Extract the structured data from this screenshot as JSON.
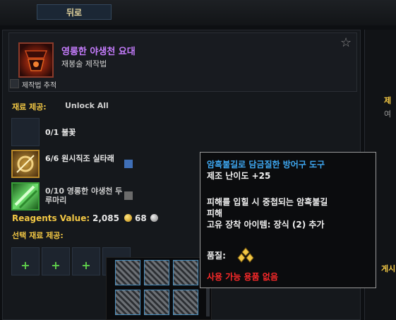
{
  "nav": {
    "back_label": "뒤로"
  },
  "recipe": {
    "name": "영롱한 야생천 요대",
    "subtitle": "재봉술 제작법",
    "track_label": "제작법 추적",
    "favorite_icon": "star-icon"
  },
  "reagents_section": {
    "label": "재료 제공:",
    "unlock_all": "Unlock All",
    "rows": [
      {
        "text": "0/1 불꽃",
        "icon": "empty-slot"
      },
      {
        "text": "6/6 원시직조 실타래",
        "icon": "thread-icon",
        "quality_color": "#3f6fb7"
      },
      {
        "text": "0/10 영롱한 야생천 두루마리",
        "icon": "cloth-roll-icon",
        "quality_color": "#6b6b6b"
      }
    ]
  },
  "reagent_value": {
    "label": "Reagents Value:",
    "gold": "2,085",
    "silver": "68"
  },
  "optional_section": {
    "label": "선택 재료 제공:",
    "add_symbol": "+"
  },
  "tooltip": {
    "title": "암흑불길로 담금질한 방어구 도구",
    "difficulty": "제조 난이도 +25",
    "effect_line1": "피해를 입힐 시 중첩되는 암흑불길",
    "effect_line2": "피해",
    "unique": "고유 장착 아이템: 장식 (2) 추가",
    "quality_label": "품질:",
    "unusable": "사용 가능 용품 없음"
  },
  "right_panel": {
    "text1": "제",
    "text2": "여",
    "text3": "게시"
  },
  "colors": {
    "accent_gold": "#f2c744",
    "epic": "#c77dff",
    "rare_blue": "#3ea8f2",
    "error_red": "#ff2a2a"
  }
}
